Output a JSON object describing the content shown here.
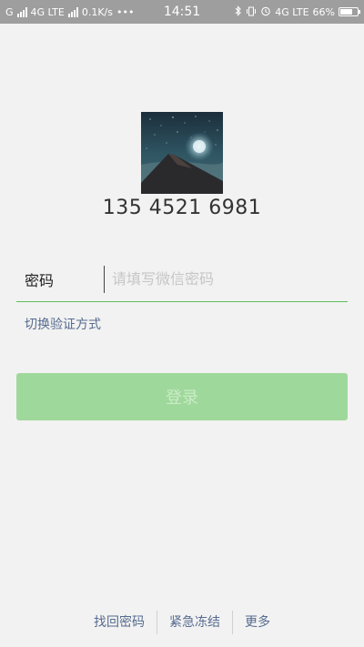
{
  "status_bar": {
    "carrier_left": "G",
    "network1": "4G LTE",
    "speed": "0.1K/s",
    "dots": "•••",
    "time": "14:51",
    "network2": "4G LTE",
    "battery_percent": "66%",
    "battery_level": 0.66
  },
  "profile": {
    "phone": "135 4521 6981"
  },
  "password": {
    "label": "密码",
    "placeholder": "请填写微信密码"
  },
  "switch_method": "切换验证方式",
  "login_button": "登录",
  "bottom_links": {
    "recover": "找回密码",
    "freeze": "紧急冻结",
    "more": "更多"
  },
  "colors": {
    "accent": "#5fbe5a",
    "button_disabled": "#9fd89b",
    "link": "#566b8f"
  }
}
